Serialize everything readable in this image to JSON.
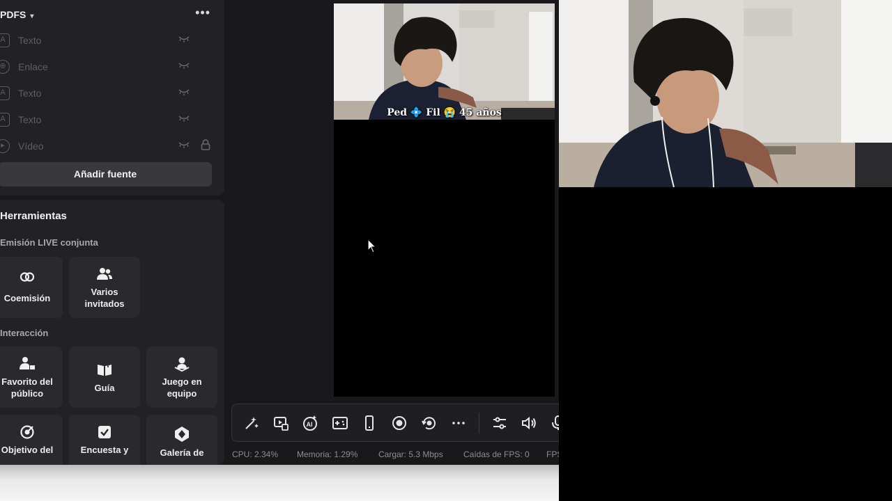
{
  "sources": {
    "title": "PDFS",
    "items": [
      {
        "label": "Texto",
        "icon": "text-icon"
      },
      {
        "label": "Enlace",
        "icon": "globe-icon"
      },
      {
        "label": "Texto",
        "icon": "text-icon"
      },
      {
        "label": "Texto",
        "icon": "text-icon"
      },
      {
        "label": "Vídeo",
        "icon": "play-icon"
      }
    ],
    "add_button": "Añadir fuente"
  },
  "tools": {
    "title": "Herramientas",
    "sections": [
      {
        "title": "Emisión LIVE conjunta",
        "tiles": [
          {
            "label": "Coemisión",
            "icon": "link-icon"
          },
          {
            "label": "Varios invitados",
            "icon": "users-icon"
          }
        ]
      },
      {
        "title": "Interacción",
        "tiles": [
          {
            "label": "Favorito del público",
            "icon": "audience-icon"
          },
          {
            "label": "Guía",
            "icon": "book-icon"
          },
          {
            "label": "Juego en equipo",
            "icon": "team-game-icon"
          }
        ]
      },
      {
        "title": "",
        "tiles": [
          {
            "label": "Objetivo del",
            "icon": "target-icon"
          },
          {
            "label": "Encuesta y",
            "icon": "poll-icon"
          },
          {
            "label": "Galería de",
            "icon": "gallery-icon"
          }
        ]
      }
    ]
  },
  "preview": {
    "overlay_text": "Ped 💠 Fil 😭 45 años"
  },
  "stats": {
    "cpu": "CPU:  2.34%",
    "memory": "Memoria:  1.29%",
    "upload": "Cargar:  5.3 Mbps",
    "fps_drops": "Caídas de FPS:  0",
    "fps": "FPS"
  },
  "colors": {
    "panel_bg": "#222226",
    "app_bg": "#19191c",
    "tile_bg": "#2a2a2e",
    "button_bg": "#38383d"
  }
}
